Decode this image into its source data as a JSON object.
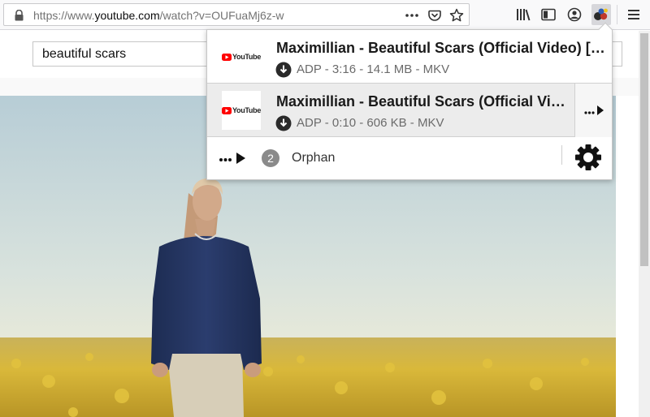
{
  "browser": {
    "url_prefix": "https://www.",
    "url_host": "youtube.com",
    "url_path": "/watch?v=OUFuaMj6z-w"
  },
  "youtube": {
    "search_value": "beautiful scars"
  },
  "popup": {
    "items": [
      {
        "thumb_label": "YouTube",
        "title": "Maximillian - Beautiful Scars (Official Video) [ADP]",
        "meta": "ADP - 3:16 - 14.1 MB - MKV"
      },
      {
        "thumb_label": "YouTube",
        "title": "Maximillian - Beautiful Scars (Official Video) [ADP]",
        "meta": "ADP - 0:10 - 606 KB - MKV"
      }
    ],
    "footer": {
      "orphan_count": "2",
      "orphan_label": "Orphan"
    }
  },
  "icons": {
    "lock": "lock-icon",
    "page_actions": "more-dots-icon",
    "pocket": "pocket-icon",
    "bookmark": "star-icon",
    "library": "library-icon",
    "sidebar": "sidebar-icon",
    "account": "account-icon",
    "extension": "video-downloadhelper-icon",
    "menu": "hamburger-menu-icon",
    "download": "download-circle-icon",
    "more": "more-actions-icon",
    "settings": "gear-icon"
  },
  "colors": {
    "youtube_red": "#ff0000",
    "sky_top": "#b7cdd6",
    "field_yellow": "#d7b63a"
  }
}
